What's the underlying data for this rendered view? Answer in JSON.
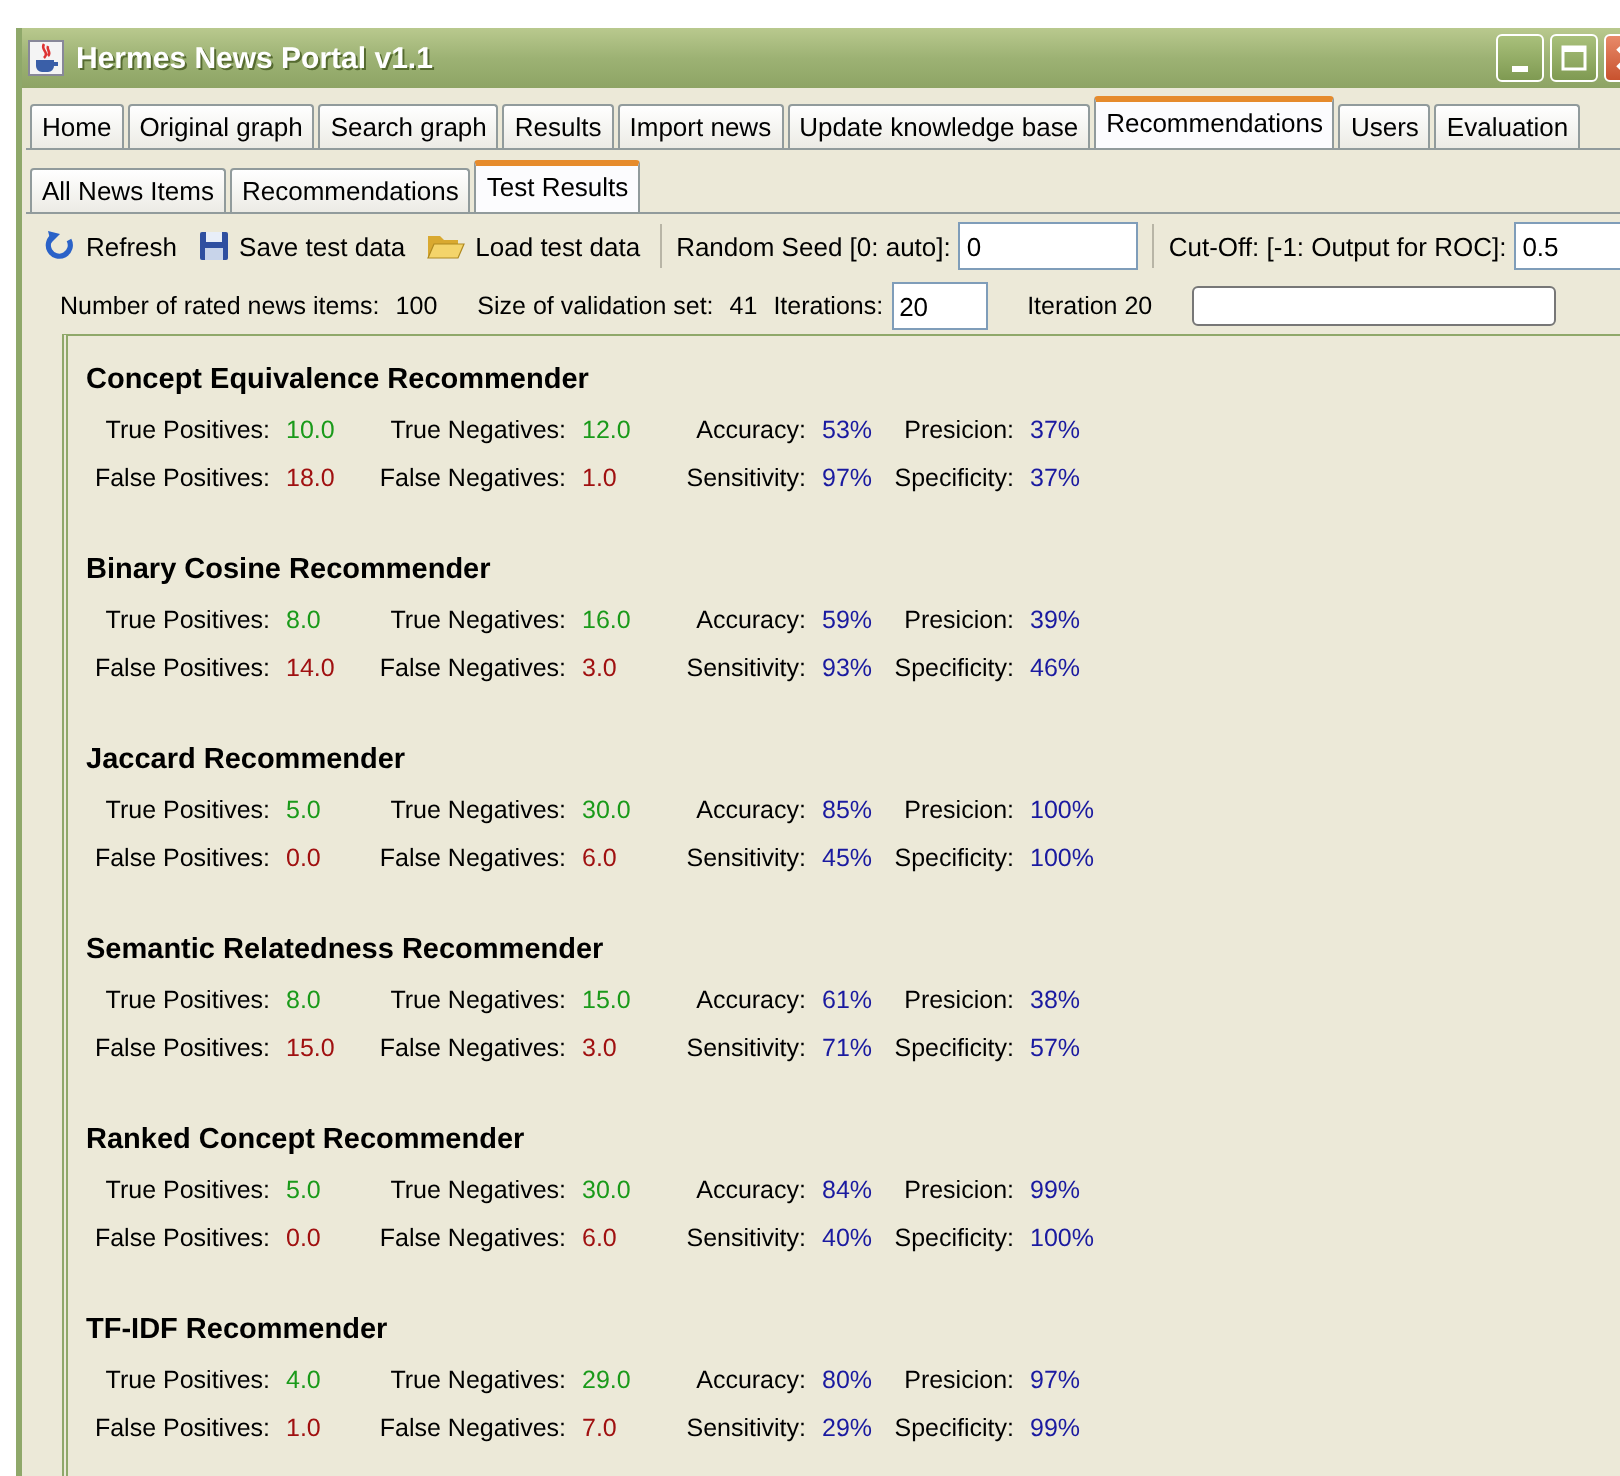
{
  "window": {
    "title": "Hermes News Portal v1.1"
  },
  "main_tabs": [
    {
      "label": "Home",
      "selected": false
    },
    {
      "label": "Original graph",
      "selected": false
    },
    {
      "label": "Search graph",
      "selected": false
    },
    {
      "label": "Results",
      "selected": false
    },
    {
      "label": "Import news",
      "selected": false
    },
    {
      "label": "Update knowledge base",
      "selected": false
    },
    {
      "label": "Recommendations",
      "selected": true
    },
    {
      "label": "Users",
      "selected": false
    },
    {
      "label": "Evaluation",
      "selected": false
    }
  ],
  "sub_tabs": [
    {
      "label": "All News Items",
      "selected": false
    },
    {
      "label": "Recommendations",
      "selected": false
    },
    {
      "label": "Test Results",
      "selected": true
    }
  ],
  "toolbar": {
    "buttons": [
      {
        "label": "Refresh"
      },
      {
        "label": "Save test data"
      },
      {
        "label": "Load test data"
      }
    ],
    "random_seed": {
      "label": "Random Seed [0: auto]:",
      "value": "0"
    },
    "cutoff": {
      "label": "Cut-Off: [-1: Output for ROC]:",
      "value": "0.5"
    }
  },
  "info": {
    "rated_label": "Number of rated news items:",
    "rated": "100",
    "validation_label": "Size of validation set:",
    "validation": "41",
    "iterations_label": "Iterations:",
    "iterations": "20",
    "iteration_status": "Iteration 20"
  },
  "recommenders": [
    {
      "name": "Concept Equivalence Recommender",
      "rows": [
        [
          {
            "label": "True Positives:",
            "value": "10.0",
            "kind": "true"
          },
          {
            "label": "True Negatives:",
            "value": "12.0",
            "kind": "true"
          },
          {
            "label": "Accuracy:",
            "value": "53%",
            "kind": "rate"
          },
          {
            "label": "Presicion:",
            "value": "37%",
            "kind": "rate"
          }
        ],
        [
          {
            "label": "False Positives:",
            "value": "18.0",
            "kind": "false"
          },
          {
            "label": "False Negatives:",
            "value": "1.0",
            "kind": "false"
          },
          {
            "label": "Sensitivity:",
            "value": "97%",
            "kind": "rate"
          },
          {
            "label": "Specificity:",
            "value": "37%",
            "kind": "rate"
          }
        ]
      ]
    },
    {
      "name": "Binary Cosine Recommender",
      "rows": [
        [
          {
            "label": "True Positives:",
            "value": "8.0",
            "kind": "true"
          },
          {
            "label": "True Negatives:",
            "value": "16.0",
            "kind": "true"
          },
          {
            "label": "Accuracy:",
            "value": "59%",
            "kind": "rate"
          },
          {
            "label": "Presicion:",
            "value": "39%",
            "kind": "rate"
          }
        ],
        [
          {
            "label": "False Positives:",
            "value": "14.0",
            "kind": "false"
          },
          {
            "label": "False Negatives:",
            "value": "3.0",
            "kind": "false"
          },
          {
            "label": "Sensitivity:",
            "value": "93%",
            "kind": "rate"
          },
          {
            "label": "Specificity:",
            "value": "46%",
            "kind": "rate"
          }
        ]
      ]
    },
    {
      "name": "Jaccard Recommender",
      "rows": [
        [
          {
            "label": "True Positives:",
            "value": "5.0",
            "kind": "true"
          },
          {
            "label": "True Negatives:",
            "value": "30.0",
            "kind": "true"
          },
          {
            "label": "Accuracy:",
            "value": "85%",
            "kind": "rate"
          },
          {
            "label": "Presicion:",
            "value": "100%",
            "kind": "rate"
          }
        ],
        [
          {
            "label": "False Positives:",
            "value": "0.0",
            "kind": "false"
          },
          {
            "label": "False Negatives:",
            "value": "6.0",
            "kind": "false"
          },
          {
            "label": "Sensitivity:",
            "value": "45%",
            "kind": "rate"
          },
          {
            "label": "Specificity:",
            "value": "100%",
            "kind": "rate"
          }
        ]
      ]
    },
    {
      "name": "Semantic Relatedness Recommender",
      "rows": [
        [
          {
            "label": "True Positives:",
            "value": "8.0",
            "kind": "true"
          },
          {
            "label": "True Negatives:",
            "value": "15.0",
            "kind": "true"
          },
          {
            "label": "Accuracy:",
            "value": "61%",
            "kind": "rate"
          },
          {
            "label": "Presicion:",
            "value": "38%",
            "kind": "rate"
          }
        ],
        [
          {
            "label": "False Positives:",
            "value": "15.0",
            "kind": "false"
          },
          {
            "label": "False Negatives:",
            "value": "3.0",
            "kind": "false"
          },
          {
            "label": "Sensitivity:",
            "value": "71%",
            "kind": "rate"
          },
          {
            "label": "Specificity:",
            "value": "57%",
            "kind": "rate"
          }
        ]
      ]
    },
    {
      "name": "Ranked Concept Recommender",
      "rows": [
        [
          {
            "label": "True Positives:",
            "value": "5.0",
            "kind": "true"
          },
          {
            "label": "True Negatives:",
            "value": "30.0",
            "kind": "true"
          },
          {
            "label": "Accuracy:",
            "value": "84%",
            "kind": "rate"
          },
          {
            "label": "Presicion:",
            "value": "99%",
            "kind": "rate"
          }
        ],
        [
          {
            "label": "False Positives:",
            "value": "0.0",
            "kind": "false"
          },
          {
            "label": "False Negatives:",
            "value": "6.0",
            "kind": "false"
          },
          {
            "label": "Sensitivity:",
            "value": "40%",
            "kind": "rate"
          },
          {
            "label": "Specificity:",
            "value": "100%",
            "kind": "rate"
          }
        ]
      ]
    },
    {
      "name": "TF-IDF Recommender",
      "rows": [
        [
          {
            "label": "True Positives:",
            "value": "4.0",
            "kind": "true"
          },
          {
            "label": "True Negatives:",
            "value": "29.0",
            "kind": "true"
          },
          {
            "label": "Accuracy:",
            "value": "80%",
            "kind": "rate"
          },
          {
            "label": "Presicion:",
            "value": "97%",
            "kind": "rate"
          }
        ],
        [
          {
            "label": "False Positives:",
            "value": "1.0",
            "kind": "false"
          },
          {
            "label": "False Negatives:",
            "value": "7.0",
            "kind": "false"
          },
          {
            "label": "Sensitivity:",
            "value": "29%",
            "kind": "rate"
          },
          {
            "label": "Specificity:",
            "value": "99%",
            "kind": "rate"
          }
        ]
      ]
    }
  ]
}
